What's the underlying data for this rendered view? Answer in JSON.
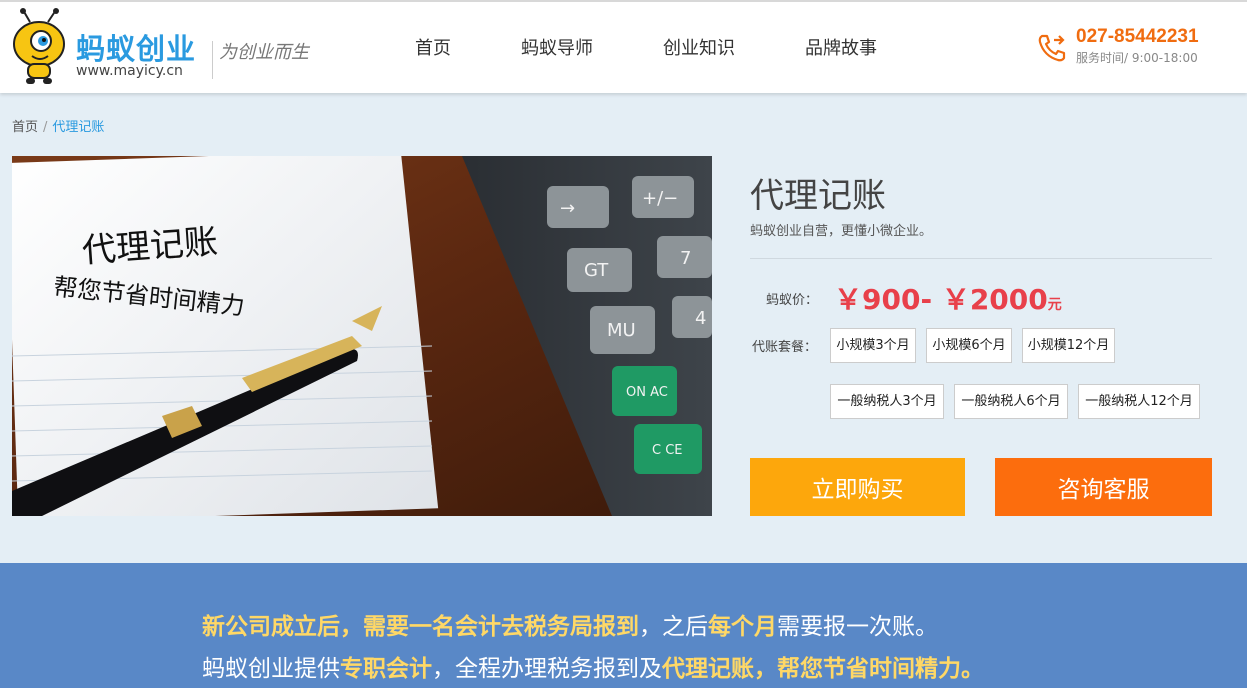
{
  "header": {
    "brand": "蚂蚁创业",
    "url": "www.mayicy.cn",
    "slogan": "为创业而生",
    "nav": [
      "首页",
      "蚂蚁导师",
      "创业知识",
      "品牌故事"
    ],
    "phone": "027-85442231",
    "hours": "服务时间/ 9:00-18:00"
  },
  "breadcrumb": {
    "home": "首页",
    "sep": "/",
    "current": "代理记账"
  },
  "hero": {
    "line1": "代理记账",
    "line2": "帮您节省时间精力",
    "keys": [
      "→",
      "+/−",
      "7",
      "GT",
      "4",
      "MU",
      "ON AC",
      "C CE"
    ]
  },
  "product": {
    "title": "代理记账",
    "subtitle": "蚂蚁创业自营，更懂小微企业。",
    "price_label": "蚂蚁价：",
    "price": "￥900- ￥2000",
    "price_unit": "元",
    "package_label": "代账套餐：",
    "packages_row1": [
      "小规模3个月",
      "小规模6个月",
      "小规模12个月"
    ],
    "packages_row2": [
      "一般纳税人3个月",
      "一般纳税人6个月",
      "一般纳税人12个月"
    ],
    "buy_label": "立即购买",
    "service_label": "咨询客服"
  },
  "banner": {
    "l1": [
      "新公司成立后，需要一名会计去税务局报到",
      "，之后",
      "每个月",
      "需要报一次账。"
    ],
    "l2": [
      "蚂蚁创业提供",
      "专职会计",
      "，全程办理税务报到及",
      "代理记账，帮您节省时间精力。"
    ]
  },
  "colors": {
    "accent": "#2a9ae0",
    "price": "#e8404a",
    "buy": "#fda70c",
    "service": "#fc6d0d",
    "banner": "#5988c7",
    "highlight": "#ffd866"
  }
}
